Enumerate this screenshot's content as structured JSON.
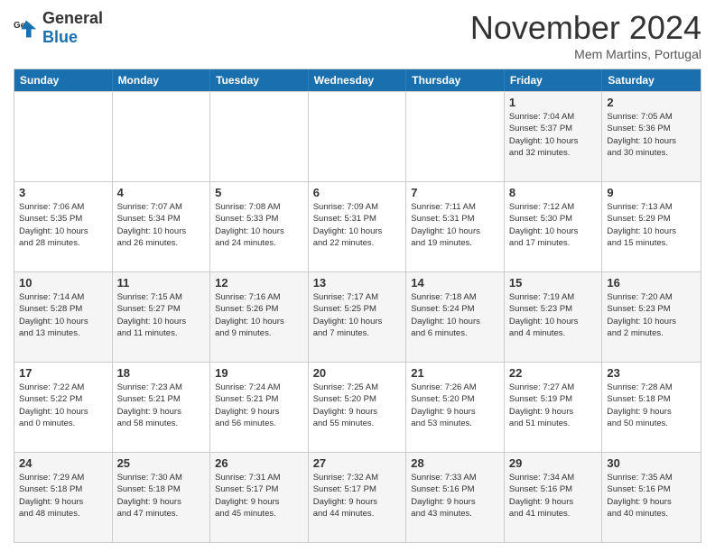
{
  "logo": {
    "general": "General",
    "blue": "Blue"
  },
  "title": "November 2024",
  "location": "Mem Martins, Portugal",
  "weekdays": [
    "Sunday",
    "Monday",
    "Tuesday",
    "Wednesday",
    "Thursday",
    "Friday",
    "Saturday"
  ],
  "weeks": [
    [
      {
        "day": "",
        "info": "",
        "empty": true
      },
      {
        "day": "",
        "info": "",
        "empty": true
      },
      {
        "day": "",
        "info": "",
        "empty": true
      },
      {
        "day": "",
        "info": "",
        "empty": true
      },
      {
        "day": "",
        "info": "",
        "empty": true
      },
      {
        "day": "1",
        "info": "Sunrise: 7:04 AM\nSunset: 5:37 PM\nDaylight: 10 hours\nand 32 minutes.",
        "empty": false
      },
      {
        "day": "2",
        "info": "Sunrise: 7:05 AM\nSunset: 5:36 PM\nDaylight: 10 hours\nand 30 minutes.",
        "empty": false
      }
    ],
    [
      {
        "day": "3",
        "info": "Sunrise: 7:06 AM\nSunset: 5:35 PM\nDaylight: 10 hours\nand 28 minutes.",
        "empty": false
      },
      {
        "day": "4",
        "info": "Sunrise: 7:07 AM\nSunset: 5:34 PM\nDaylight: 10 hours\nand 26 minutes.",
        "empty": false
      },
      {
        "day": "5",
        "info": "Sunrise: 7:08 AM\nSunset: 5:33 PM\nDaylight: 10 hours\nand 24 minutes.",
        "empty": false
      },
      {
        "day": "6",
        "info": "Sunrise: 7:09 AM\nSunset: 5:31 PM\nDaylight: 10 hours\nand 22 minutes.",
        "empty": false
      },
      {
        "day": "7",
        "info": "Sunrise: 7:11 AM\nSunset: 5:31 PM\nDaylight: 10 hours\nand 19 minutes.",
        "empty": false
      },
      {
        "day": "8",
        "info": "Sunrise: 7:12 AM\nSunset: 5:30 PM\nDaylight: 10 hours\nand 17 minutes.",
        "empty": false
      },
      {
        "day": "9",
        "info": "Sunrise: 7:13 AM\nSunset: 5:29 PM\nDaylight: 10 hours\nand 15 minutes.",
        "empty": false
      }
    ],
    [
      {
        "day": "10",
        "info": "Sunrise: 7:14 AM\nSunset: 5:28 PM\nDaylight: 10 hours\nand 13 minutes.",
        "empty": false
      },
      {
        "day": "11",
        "info": "Sunrise: 7:15 AM\nSunset: 5:27 PM\nDaylight: 10 hours\nand 11 minutes.",
        "empty": false
      },
      {
        "day": "12",
        "info": "Sunrise: 7:16 AM\nSunset: 5:26 PM\nDaylight: 10 hours\nand 9 minutes.",
        "empty": false
      },
      {
        "day": "13",
        "info": "Sunrise: 7:17 AM\nSunset: 5:25 PM\nDaylight: 10 hours\nand 7 minutes.",
        "empty": false
      },
      {
        "day": "14",
        "info": "Sunrise: 7:18 AM\nSunset: 5:24 PM\nDaylight: 10 hours\nand 6 minutes.",
        "empty": false
      },
      {
        "day": "15",
        "info": "Sunrise: 7:19 AM\nSunset: 5:23 PM\nDaylight: 10 hours\nand 4 minutes.",
        "empty": false
      },
      {
        "day": "16",
        "info": "Sunrise: 7:20 AM\nSunset: 5:23 PM\nDaylight: 10 hours\nand 2 minutes.",
        "empty": false
      }
    ],
    [
      {
        "day": "17",
        "info": "Sunrise: 7:22 AM\nSunset: 5:22 PM\nDaylight: 10 hours\nand 0 minutes.",
        "empty": false
      },
      {
        "day": "18",
        "info": "Sunrise: 7:23 AM\nSunset: 5:21 PM\nDaylight: 9 hours\nand 58 minutes.",
        "empty": false
      },
      {
        "day": "19",
        "info": "Sunrise: 7:24 AM\nSunset: 5:21 PM\nDaylight: 9 hours\nand 56 minutes.",
        "empty": false
      },
      {
        "day": "20",
        "info": "Sunrise: 7:25 AM\nSunset: 5:20 PM\nDaylight: 9 hours\nand 55 minutes.",
        "empty": false
      },
      {
        "day": "21",
        "info": "Sunrise: 7:26 AM\nSunset: 5:20 PM\nDaylight: 9 hours\nand 53 minutes.",
        "empty": false
      },
      {
        "day": "22",
        "info": "Sunrise: 7:27 AM\nSunset: 5:19 PM\nDaylight: 9 hours\nand 51 minutes.",
        "empty": false
      },
      {
        "day": "23",
        "info": "Sunrise: 7:28 AM\nSunset: 5:18 PM\nDaylight: 9 hours\nand 50 minutes.",
        "empty": false
      }
    ],
    [
      {
        "day": "24",
        "info": "Sunrise: 7:29 AM\nSunset: 5:18 PM\nDaylight: 9 hours\nand 48 minutes.",
        "empty": false
      },
      {
        "day": "25",
        "info": "Sunrise: 7:30 AM\nSunset: 5:18 PM\nDaylight: 9 hours\nand 47 minutes.",
        "empty": false
      },
      {
        "day": "26",
        "info": "Sunrise: 7:31 AM\nSunset: 5:17 PM\nDaylight: 9 hours\nand 45 minutes.",
        "empty": false
      },
      {
        "day": "27",
        "info": "Sunrise: 7:32 AM\nSunset: 5:17 PM\nDaylight: 9 hours\nand 44 minutes.",
        "empty": false
      },
      {
        "day": "28",
        "info": "Sunrise: 7:33 AM\nSunset: 5:16 PM\nDaylight: 9 hours\nand 43 minutes.",
        "empty": false
      },
      {
        "day": "29",
        "info": "Sunrise: 7:34 AM\nSunset: 5:16 PM\nDaylight: 9 hours\nand 41 minutes.",
        "empty": false
      },
      {
        "day": "30",
        "info": "Sunrise: 7:35 AM\nSunset: 5:16 PM\nDaylight: 9 hours\nand 40 minutes.",
        "empty": false
      }
    ]
  ]
}
